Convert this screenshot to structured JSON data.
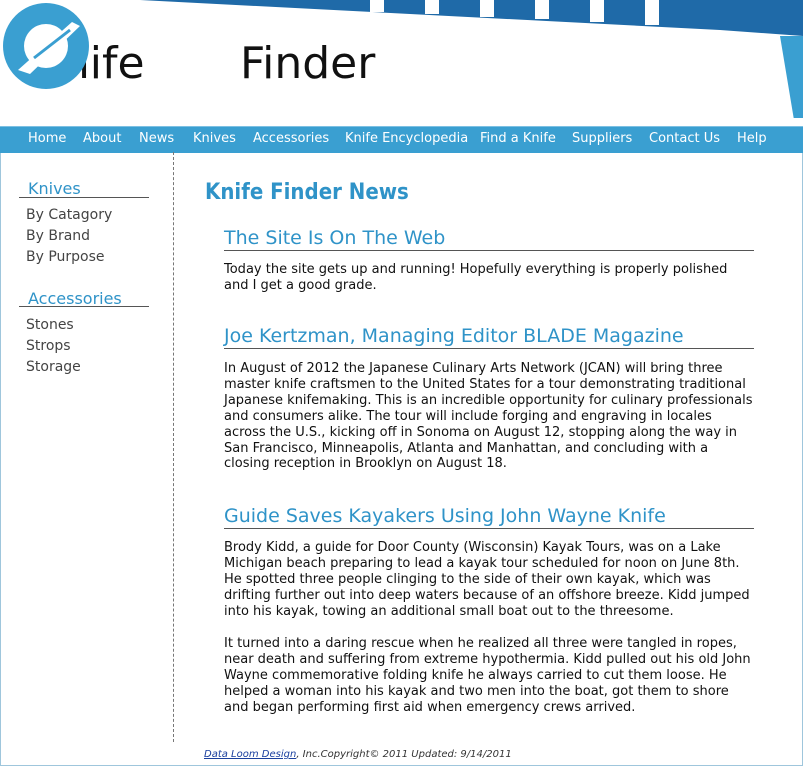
{
  "site": {
    "logo_left": "Knife",
    "logo_right": "Finder"
  },
  "nav": {
    "items": [
      "Home",
      "About",
      "News",
      "Knives",
      "Accessories",
      "Knife Encyclopedia",
      "Find a Knife",
      "Suppliers",
      "Contact Us",
      "Help"
    ]
  },
  "sidebar": {
    "knives_heading": "Knives",
    "knives_links": [
      "By Catagory",
      "By Brand",
      "By Purpose"
    ],
    "accessories_heading": "Accessories",
    "accessories_links": [
      "Stones",
      "Strops",
      "Storage"
    ]
  },
  "main": {
    "page_title": "Knife Finder News",
    "articles": [
      {
        "title": "The Site Is On The Web",
        "paragraphs": [
          "Today the site gets up and running! Hopefully everything is properly polished and I get a good grade."
        ]
      },
      {
        "title": "Joe Kertzman, Managing Editor BLADE Magazine",
        "paragraphs": [
          "In August of 2012 the Japanese Culinary Arts Network (JCAN) will bring three master knife craftsmen to the United States for a tour demonstrating traditional Japanese knifemaking. This is an incredible opportunity for culinary professionals and consumers alike. The tour will include forging and engraving in locales across the U.S., kicking off in Sonoma on August 12, stopping along the way in San Francisco, Minneapolis, Atlanta and Manhattan, and concluding with a closing reception in Brooklyn on August 18."
        ]
      },
      {
        "title": "Guide Saves Kayakers Using John Wayne Knife",
        "paragraphs": [
          "Brody Kidd, a guide for Door County (Wisconsin) Kayak Tours, was on a Lake Michigan beach preparing to lead a kayak tour scheduled for noon on June 8th. He spotted three people clinging to the side of their own kayak, which was drifting further out into deep waters because of an offshore breeze. Kidd jumped into his kayak, towing an additional small boat out to the threesome.",
          "It turned into a daring rescue when he realized all three were tangled in ropes, near death and suffering from extreme hypothermia. Kidd pulled out his old John Wayne commemorative folding knife he always carried to cut them loose. He helped a woman into his kayak and two men into the boat, got them to shore and began performing first aid when emergency crews arrived."
        ]
      }
    ]
  },
  "footer": {
    "link_text": "Data Loom Design",
    "rest_text": ", Inc.Copyright© 2011 Updated: 9/14/2011"
  },
  "colors": {
    "accent": "#3a9fd1",
    "heading": "#2f93c8"
  },
  "icons": [
    "knife-finder-logo-icon"
  ]
}
